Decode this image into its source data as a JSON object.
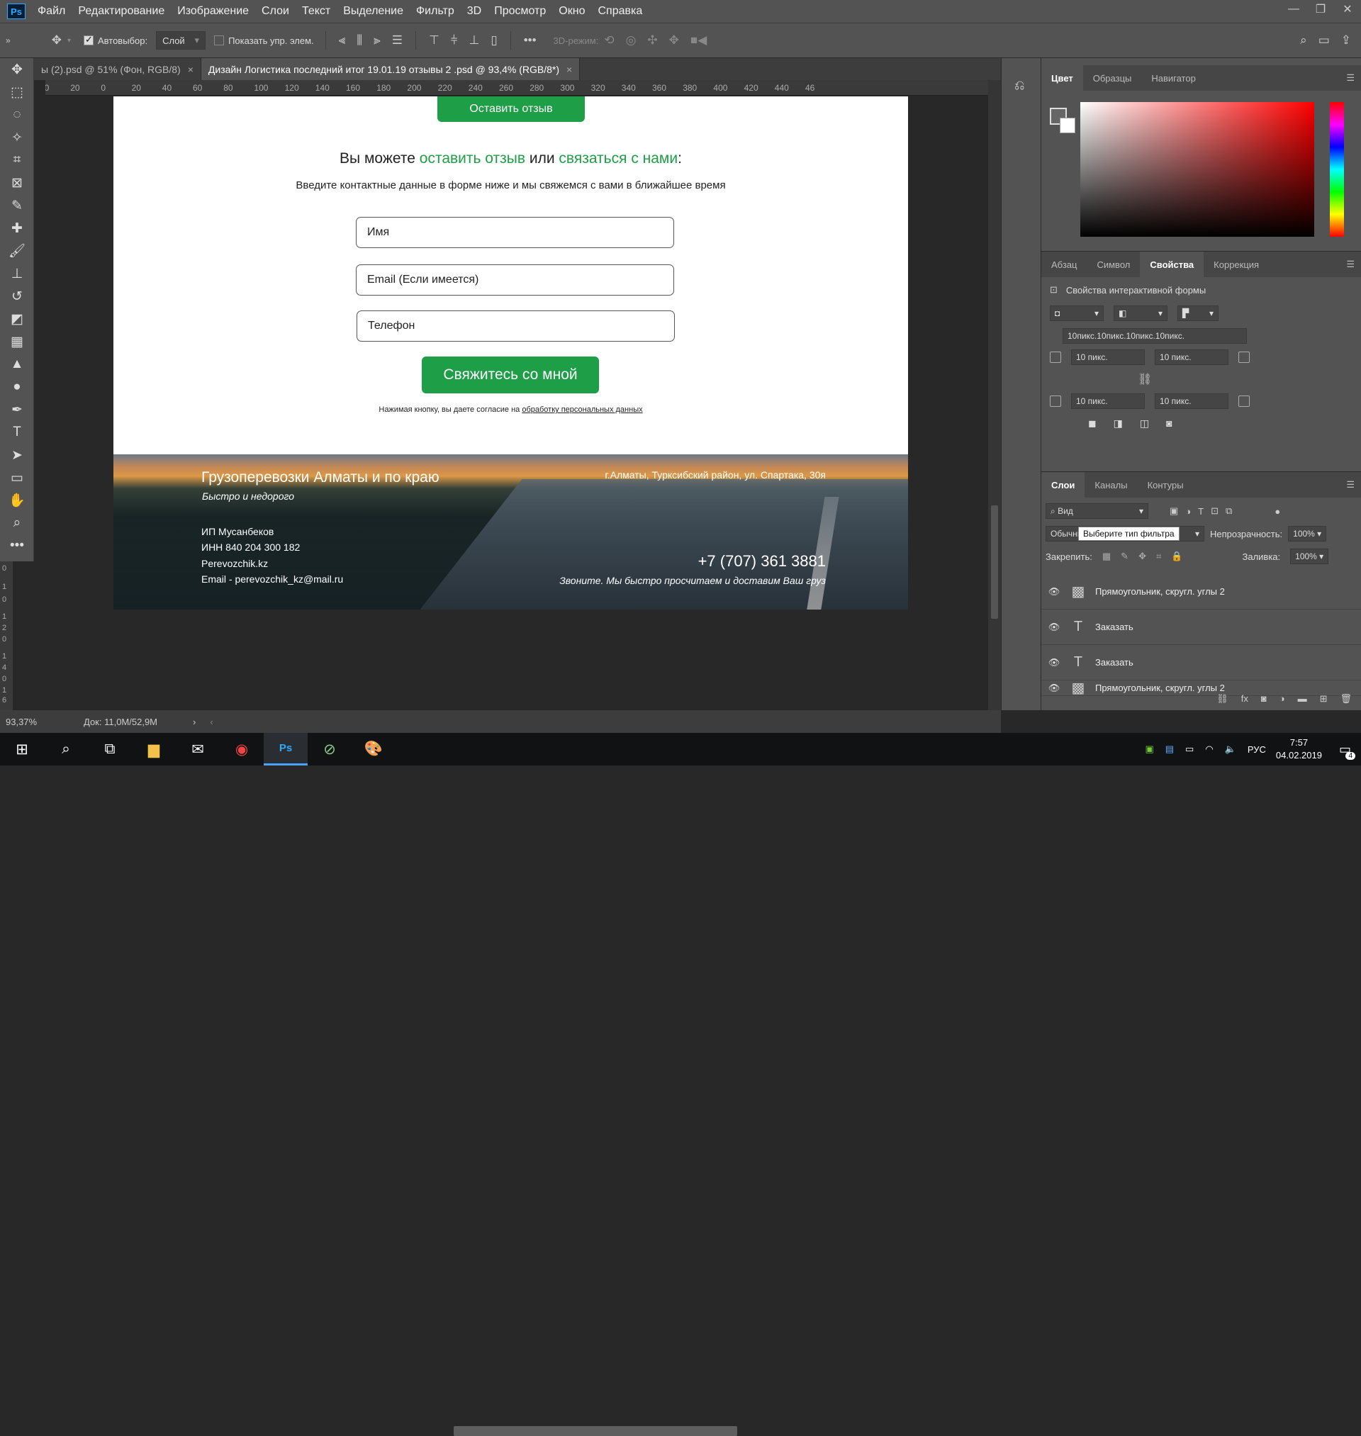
{
  "app": {
    "logo": "Ps"
  },
  "menu": [
    "Файл",
    "Редактирование",
    "Изображение",
    "Слои",
    "Текст",
    "Выделение",
    "Фильтр",
    "3D",
    "Просмотр",
    "Окно",
    "Справка"
  ],
  "window_controls": [
    "—",
    "❐",
    "✕"
  ],
  "options": {
    "autoselect_label": "Автовыбор:",
    "layer_select": "Слой",
    "show_transform_label": "Показать упр. элем.",
    "mode3d_label": "3D-режим:"
  },
  "tabs": [
    {
      "label": "ы (2).psd @ 51% (Фон, RGB/8)",
      "close": "×"
    },
    {
      "label": "Дизайн Логистика последний итог 19.01.19 отзывы 2  .psd @ 93,4% (RGB/8*)",
      "close": "×"
    }
  ],
  "ruler_ticks": [
    "40",
    "20",
    "0",
    "20",
    "40",
    "60",
    "80",
    "100",
    "120",
    "140",
    "160",
    "180",
    "200",
    "220",
    "240",
    "260",
    "280",
    "300",
    "320",
    "340",
    "360",
    "380",
    "400",
    "420",
    "440",
    "46"
  ],
  "ruler_left": [
    "0",
    "1",
    "0",
    "1",
    "2",
    "0",
    "1",
    "4",
    "0",
    "1",
    "6",
    "0"
  ],
  "doc": {
    "top_button": "Оставить отзыв",
    "headline_a": "Вы можете ",
    "headline_b": "оставить отзыв",
    "headline_c": " или ",
    "headline_d": "связаться с нами",
    "headline_e": ":",
    "subline": "Введите контактные данные в форме ниже и мы свяжемся с вами в ближайшее время",
    "field_name": "Имя",
    "field_email": "Email (Если имеется)",
    "field_phone": "Телефон",
    "submit": "Свяжитесь со мной",
    "consent_a": "Нажимая кнопку, вы даете согласие на ",
    "consent_link": "обработку персональных данных",
    "footer": {
      "title": "Грузоперевозки Алматы и по краю",
      "tagline": "Быстро и недорого",
      "address": "г.Алматы, Турксибский район, ул. Спартака, 30я",
      "company": "ИП Мусанбеков",
      "inn": "ИНН 840 204 300 182",
      "site": "Perevozchik.kz",
      "email": "Email - perevozchik_kz@mail.ru",
      "phone": "+7 (707) 361 3881",
      "phone_note": "Звоните. Мы быстро просчитаем и доставим Ваш груз"
    }
  },
  "panels": {
    "color_tabs": [
      "Цвет",
      "Образцы",
      "Навигатор"
    ],
    "props_tabs": [
      "Абзац",
      "Символ",
      "Свойства",
      "Коррекция"
    ],
    "props_title": "Свойства интерактивной формы",
    "radius_all": "10пикс.10пикс.10пикс.10пикс.",
    "r1": "10 пикс.",
    "r2": "10 пикс.",
    "r3": "10 пикс.",
    "r4": "10 пикс.",
    "layers_tabs": [
      "Слои",
      "Каналы",
      "Контуры"
    ],
    "filter_kind": "Вид",
    "tooltip": "Выберите тип фильтра",
    "blend_mode": "Обычные",
    "opacity_label": "Непрозрачность:",
    "opacity": "100%",
    "lock_label": "Закрепить:",
    "fill_label": "Заливка:",
    "fill": "100%",
    "layers": [
      {
        "name": "Прямоугольник, скругл. углы 2",
        "kind": "shape"
      },
      {
        "name": "Заказать",
        "kind": "text"
      },
      {
        "name": "Заказать",
        "kind": "text"
      },
      {
        "name": "Прямоугольник, скругл. углы 2",
        "kind": "shape"
      }
    ]
  },
  "status": {
    "zoom": "93,37%",
    "doc": "Док: 11,0M/52,9M"
  },
  "taskbar": {
    "lang": "РУС",
    "time": "7:57",
    "date": "04.02.2019",
    "notif": "4"
  }
}
